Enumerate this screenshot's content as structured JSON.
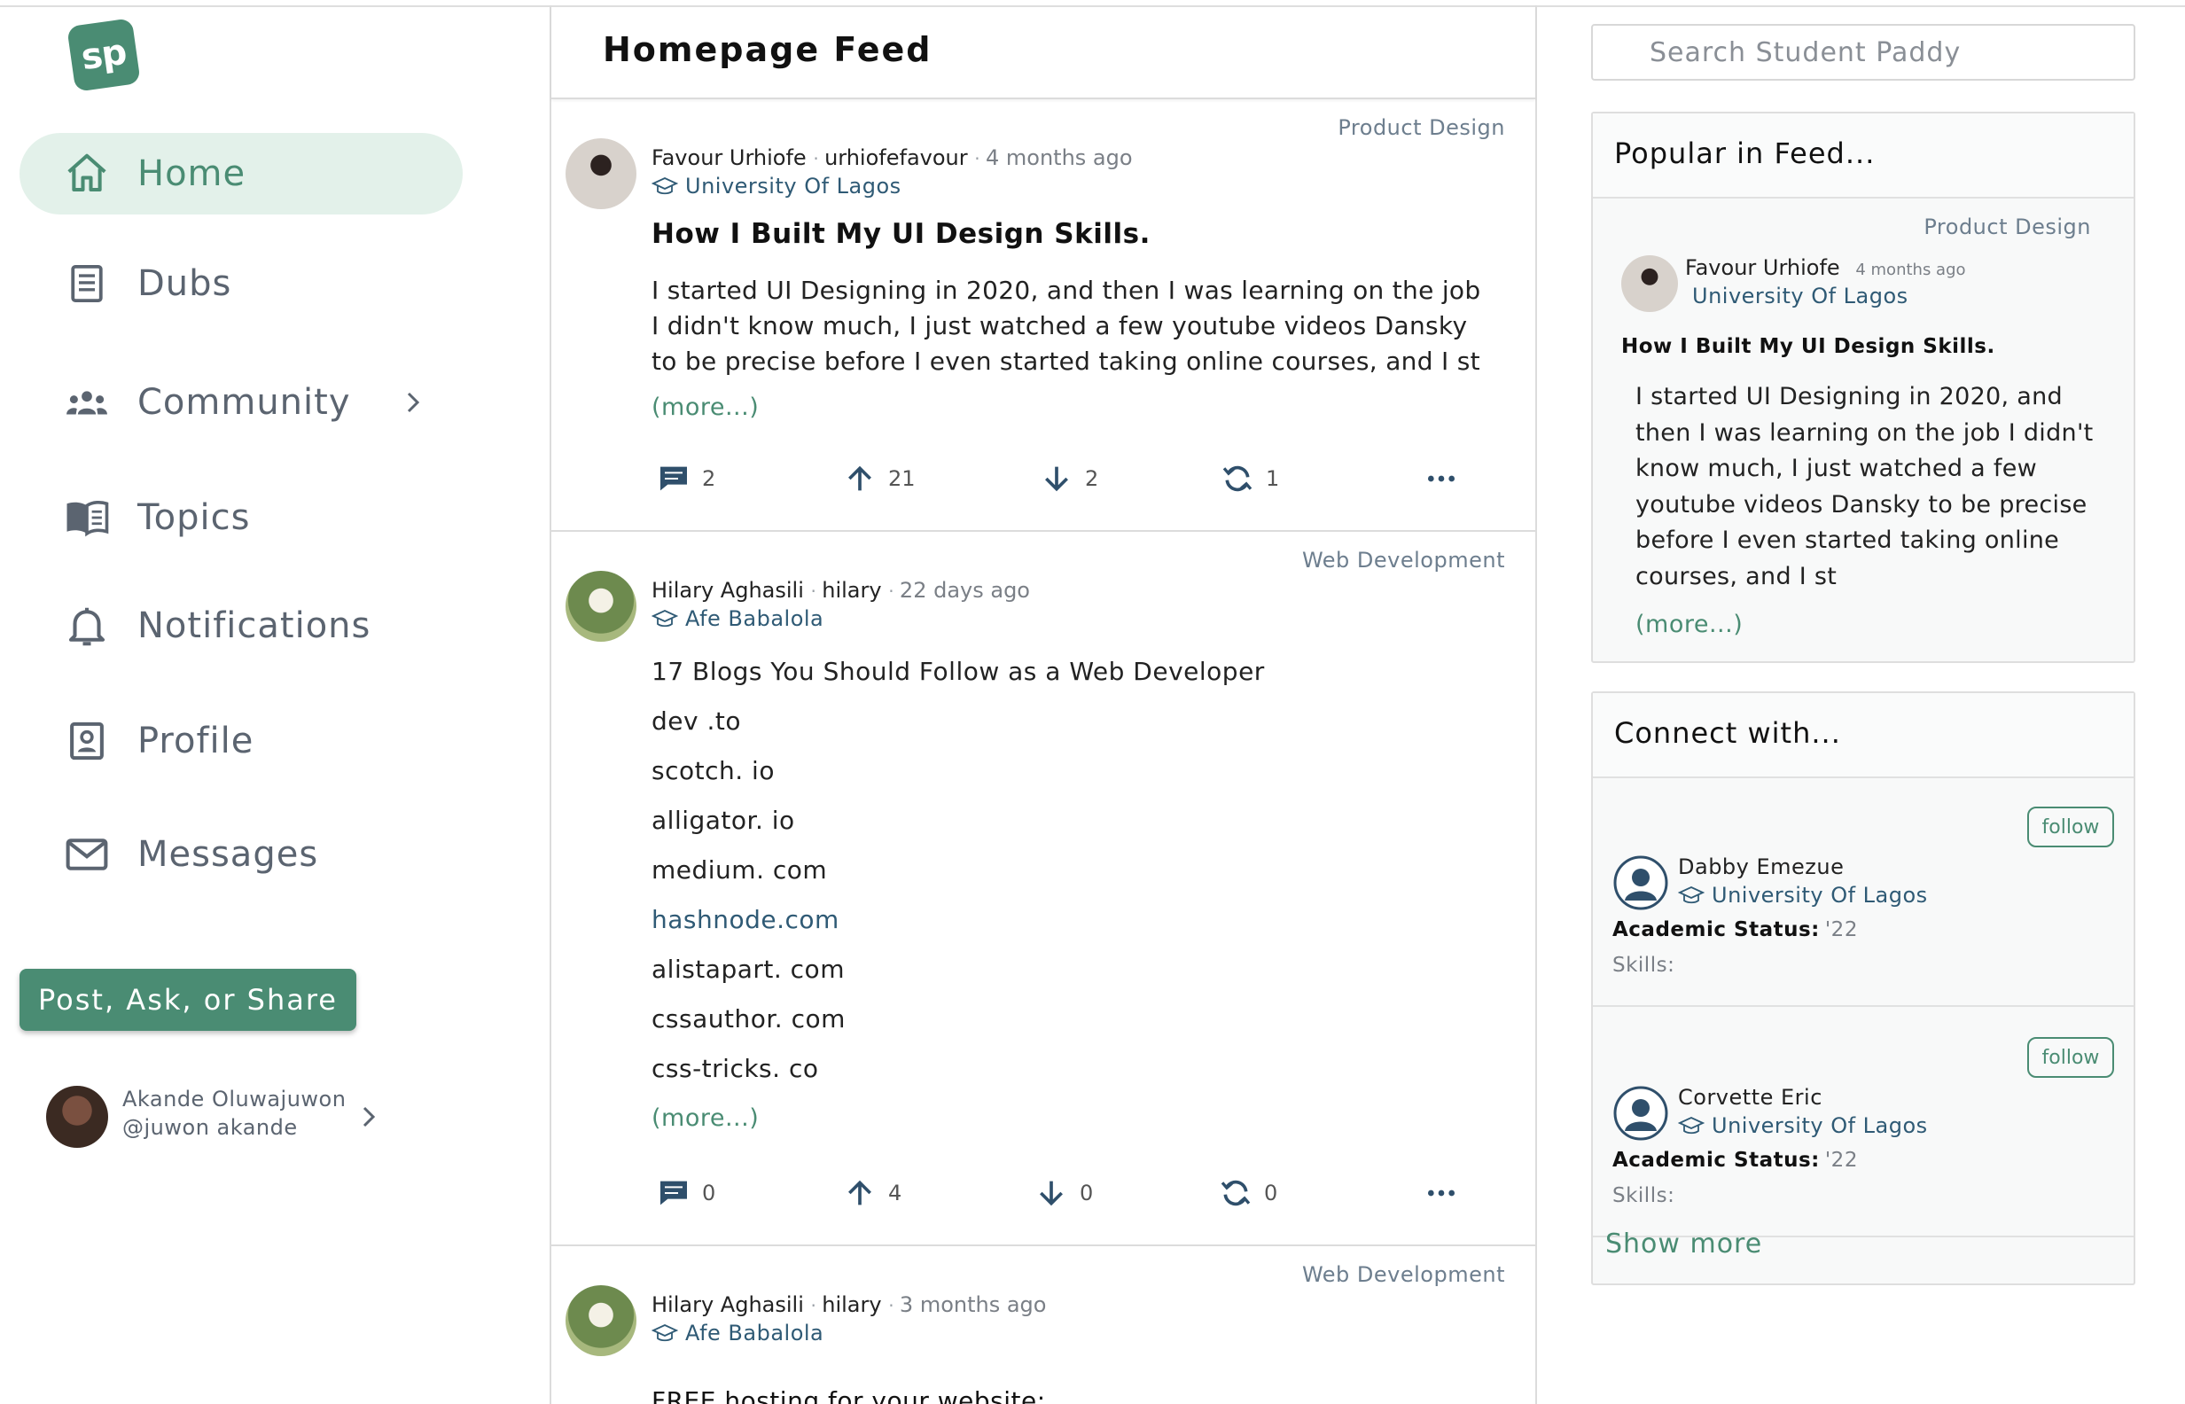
{
  "app": {
    "logo_text": "sp",
    "brand_color": "#4a8c73"
  },
  "sidebar": {
    "items": [
      {
        "label": "Home",
        "icon": "home-icon",
        "active": true
      },
      {
        "label": "Dubs",
        "icon": "document-icon"
      },
      {
        "label": "Community",
        "icon": "group-icon",
        "has_chevron": true
      },
      {
        "label": "Topics",
        "icon": "book-icon"
      },
      {
        "label": "Notifications",
        "icon": "bell-icon"
      },
      {
        "label": "Profile",
        "icon": "id-card-icon"
      },
      {
        "label": "Messages",
        "icon": "envelope-icon"
      }
    ],
    "post_button": "Post, Ask, or Share",
    "user": {
      "name": "Akande Oluwajuwon",
      "handle": "@juwon akande"
    }
  },
  "feed": {
    "title": "Homepage Feed",
    "posts": [
      {
        "tag": "Product Design",
        "author": "Favour Urhiofe",
        "username": "urhiofefavour",
        "time": "4 months ago",
        "school": "University Of Lagos",
        "title": "How I Built My UI Design Skills.",
        "body": "I started UI Designing in 2020, and then I was learning on the job I didn't know much, I just watched a few youtube videos Dansky to be precise before I even started taking online courses, and I st",
        "more": "(more...)",
        "comments": "2",
        "upvotes": "21",
        "downvotes": "2",
        "shares": "1"
      },
      {
        "tag": "Web Development",
        "author": "Hilary Aghasili",
        "username": "hilary",
        "time": "22 days ago",
        "school": "Afe Babalola",
        "lines": [
          "17 Blogs You Should Follow as a Web Developer",
          "dev .to",
          "scotch. io",
          "alligator. io",
          "medium. com",
          "hashnode.com",
          "alistapart. com",
          "cssauthor. com",
          "css-tricks. co"
        ],
        "more": "(more...)",
        "comments": "0",
        "upvotes": "4",
        "downvotes": "0",
        "shares": "0"
      },
      {
        "tag": "Web Development",
        "author": "Hilary Aghasili",
        "username": "hilary",
        "time": "3 months ago",
        "school": "Afe Babalola",
        "title": "FREE hosting for your website:"
      }
    ]
  },
  "search": {
    "placeholder": "Search Student Paddy"
  },
  "popular": {
    "heading": "Popular in Feed...",
    "tag": "Product Design",
    "author": "Favour Urhiofe",
    "time": "4 months ago",
    "school": "University Of Lagos",
    "title": "How I Built My UI Design Skills.",
    "body": "I started UI Designing in 2020, and then I was learning on the job I didn't know much, I just watched a few youtube videos Dansky to be precise before I even started taking online courses, and I st",
    "more": "(more...)"
  },
  "connect": {
    "heading": "Connect with...",
    "people": [
      {
        "name": "Dabby Emezue",
        "school": "University Of Lagos",
        "status_label": "Academic Status:",
        "status_value": "'22",
        "skills_label": "Skills:",
        "follow": "follow"
      },
      {
        "name": "Corvette Eric",
        "school": "University Of Lagos",
        "status_label": "Academic Status:",
        "status_value": "'22",
        "skills_label": "Skills:",
        "follow": "follow"
      }
    ],
    "show_more": "Show more"
  }
}
